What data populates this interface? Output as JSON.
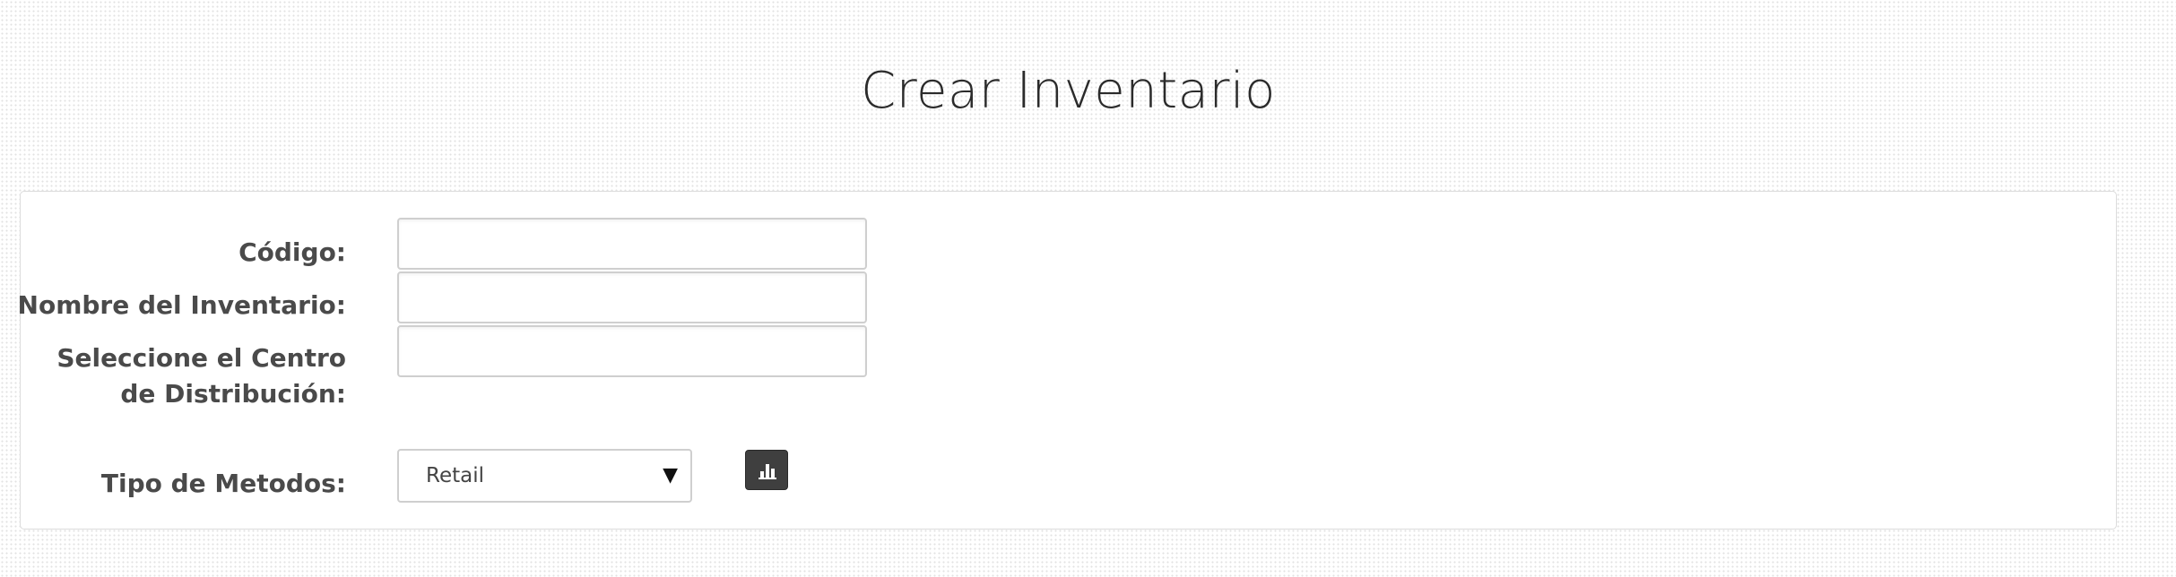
{
  "page": {
    "title": "Crear Inventario"
  },
  "form": {
    "codigo": {
      "label": "Código:",
      "value": ""
    },
    "nombre": {
      "label": "Nombre del Inventario:",
      "value": ""
    },
    "centro": {
      "label": "Seleccione el Centro de Distribución:",
      "value": ""
    },
    "tipo_metodos": {
      "label": "Tipo de Metodos:",
      "selected": "Retail",
      "arrow": "▼"
    },
    "chart_button": {
      "icon": "bar-chart-icon"
    }
  },
  "colors": {
    "button_bg": "#3f3f3f",
    "label_text": "#4a4a4a",
    "title_text": "#2b2b2b"
  }
}
